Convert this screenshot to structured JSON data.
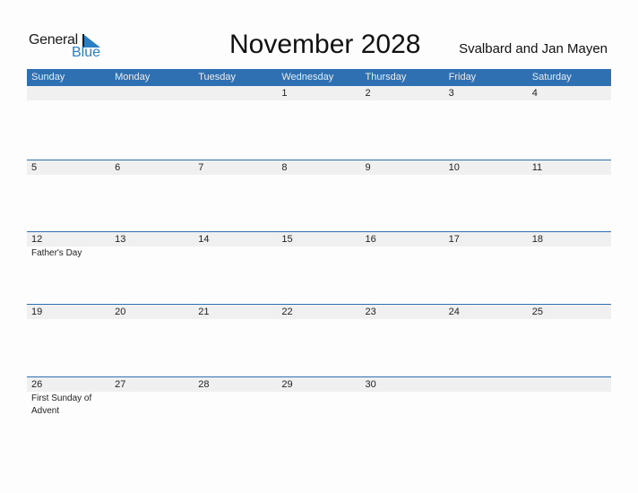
{
  "logo": {
    "line1": "General",
    "line2": "Blue",
    "accent": "#2a7fc4"
  },
  "title": "November 2028",
  "region": "Svalbard and Jan Mayen",
  "header_color": "#2e70b2",
  "weekdays": [
    "Sunday",
    "Monday",
    "Tuesday",
    "Wednesday",
    "Thursday",
    "Friday",
    "Saturday"
  ],
  "weeks": [
    {
      "days": [
        {
          "num": "",
          "event": ""
        },
        {
          "num": "",
          "event": ""
        },
        {
          "num": "",
          "event": ""
        },
        {
          "num": "1",
          "event": ""
        },
        {
          "num": "2",
          "event": ""
        },
        {
          "num": "3",
          "event": ""
        },
        {
          "num": "4",
          "event": ""
        }
      ]
    },
    {
      "days": [
        {
          "num": "5",
          "event": ""
        },
        {
          "num": "6",
          "event": ""
        },
        {
          "num": "7",
          "event": ""
        },
        {
          "num": "8",
          "event": ""
        },
        {
          "num": "9",
          "event": ""
        },
        {
          "num": "10",
          "event": ""
        },
        {
          "num": "11",
          "event": ""
        }
      ]
    },
    {
      "days": [
        {
          "num": "12",
          "event": "Father's Day"
        },
        {
          "num": "13",
          "event": ""
        },
        {
          "num": "14",
          "event": ""
        },
        {
          "num": "15",
          "event": ""
        },
        {
          "num": "16",
          "event": ""
        },
        {
          "num": "17",
          "event": ""
        },
        {
          "num": "18",
          "event": ""
        }
      ]
    },
    {
      "days": [
        {
          "num": "19",
          "event": ""
        },
        {
          "num": "20",
          "event": ""
        },
        {
          "num": "21",
          "event": ""
        },
        {
          "num": "22",
          "event": ""
        },
        {
          "num": "23",
          "event": ""
        },
        {
          "num": "24",
          "event": ""
        },
        {
          "num": "25",
          "event": ""
        }
      ]
    },
    {
      "days": [
        {
          "num": "26",
          "event": "First Sunday of Advent"
        },
        {
          "num": "27",
          "event": ""
        },
        {
          "num": "28",
          "event": ""
        },
        {
          "num": "29",
          "event": ""
        },
        {
          "num": "30",
          "event": ""
        },
        {
          "num": "",
          "event": ""
        },
        {
          "num": "",
          "event": ""
        }
      ]
    }
  ]
}
